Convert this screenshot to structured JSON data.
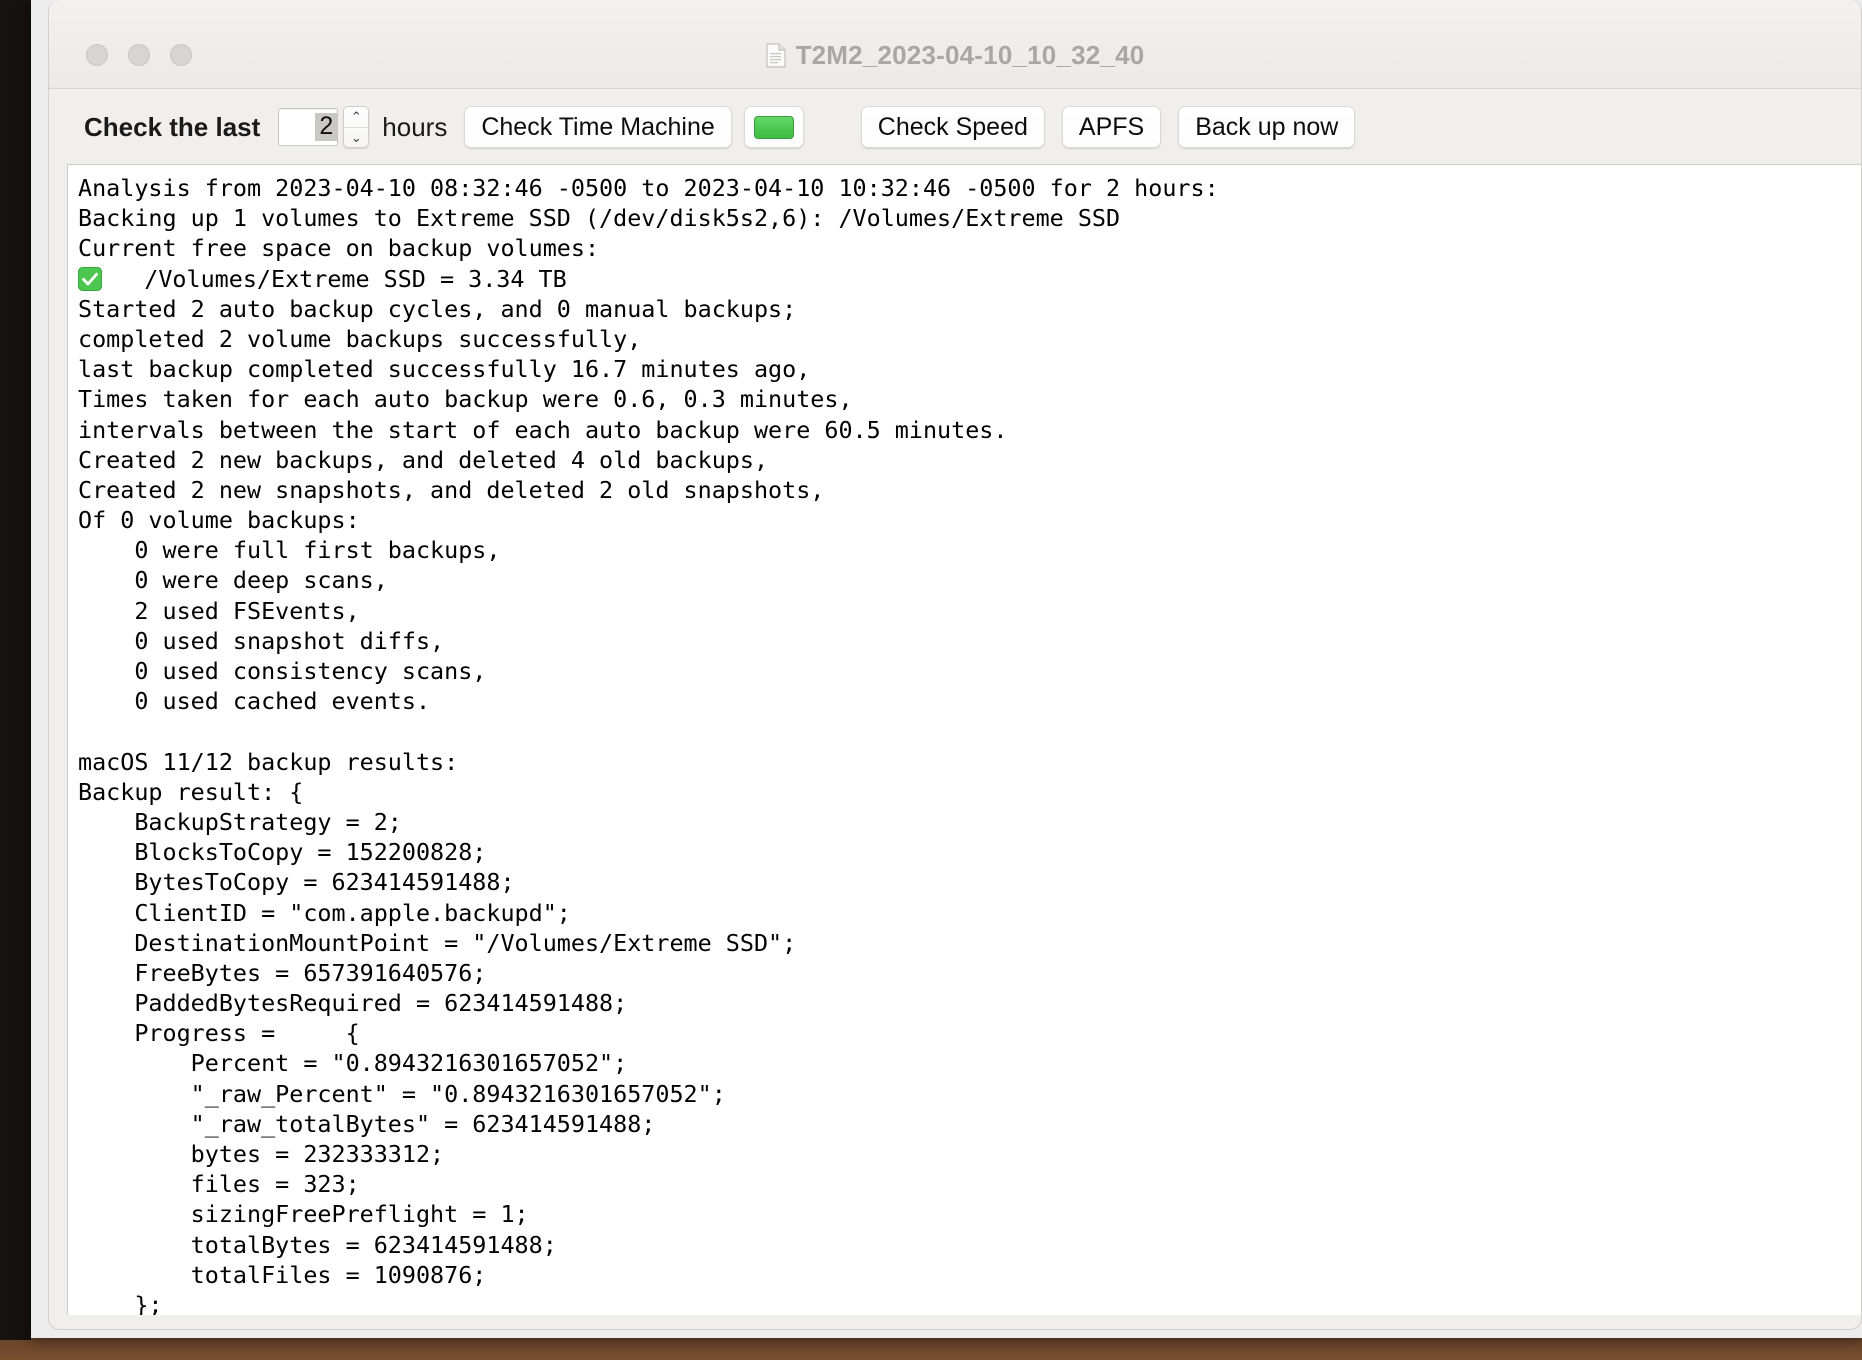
{
  "window": {
    "title": "T2M2_2023-04-10_10_32_40",
    "title_icon": "document-icon",
    "traffic_lights": [
      "close-button",
      "minimize-button",
      "zoom-button"
    ]
  },
  "toolbar": {
    "check_last_label": "Check the last",
    "hours_value": "2",
    "hours_unit_label": "hours",
    "stepper_up_glyph": "⌃",
    "stepper_down_glyph": "⌄",
    "check_time_machine_label": "Check Time Machine",
    "status_indicator_color": "#4cc84f",
    "check_speed_label": "Check Speed",
    "apfs_label": "APFS",
    "back_up_now_label": "Back up now"
  },
  "log": {
    "lines": [
      "Analysis from 2023-04-10 08:32:46 -0500 to 2023-04-10 10:32:46 -0500 for 2 hours:",
      "Backing up 1 volumes to Extreme SSD (/dev/disk5s2,6): /Volumes/Extreme SSD",
      "Current free space on backup volumes:",
      "✅   /Volumes/Extreme SSD = 3.34 TB",
      "Started 2 auto backup cycles, and 0 manual backups;",
      "completed 2 volume backups successfully,",
      "last backup completed successfully 16.7 minutes ago,",
      "Times taken for each auto backup were 0.6, 0.3 minutes,",
      "intervals between the start of each auto backup were 60.5 minutes.",
      "Created 2 new backups, and deleted 4 old backups,",
      "Created 2 new snapshots, and deleted 2 old snapshots,",
      "Of 0 volume backups:",
      "    0 were full first backups,",
      "    0 were deep scans,",
      "    2 used FSEvents,",
      "    0 used snapshot diffs,",
      "    0 used consistency scans,",
      "    0 used cached events.",
      "",
      "macOS 11/12 backup results:",
      "Backup result: {",
      "    BackupStrategy = 2;",
      "    BlocksToCopy = 152200828;",
      "    BytesToCopy = 623414591488;",
      "    ClientID = \"com.apple.backupd\";",
      "    DestinationMountPoint = \"/Volumes/Extreme SSD\";",
      "    FreeBytes = 657391640576;",
      "    PaddedBytesRequired = 623414591488;",
      "    Progress =     {",
      "        Percent = \"0.8943216301657052\";",
      "        \"_raw_Percent\" = \"0.8943216301657052\";",
      "        \"_raw_totalBytes\" = 623414591488;",
      "        bytes = 232333312;",
      "        files = 323;",
      "        sizingFreePreflight = 1;",
      "        totalBytes = 623414591488;",
      "        totalFiles = 1090876;",
      "    };"
    ]
  }
}
